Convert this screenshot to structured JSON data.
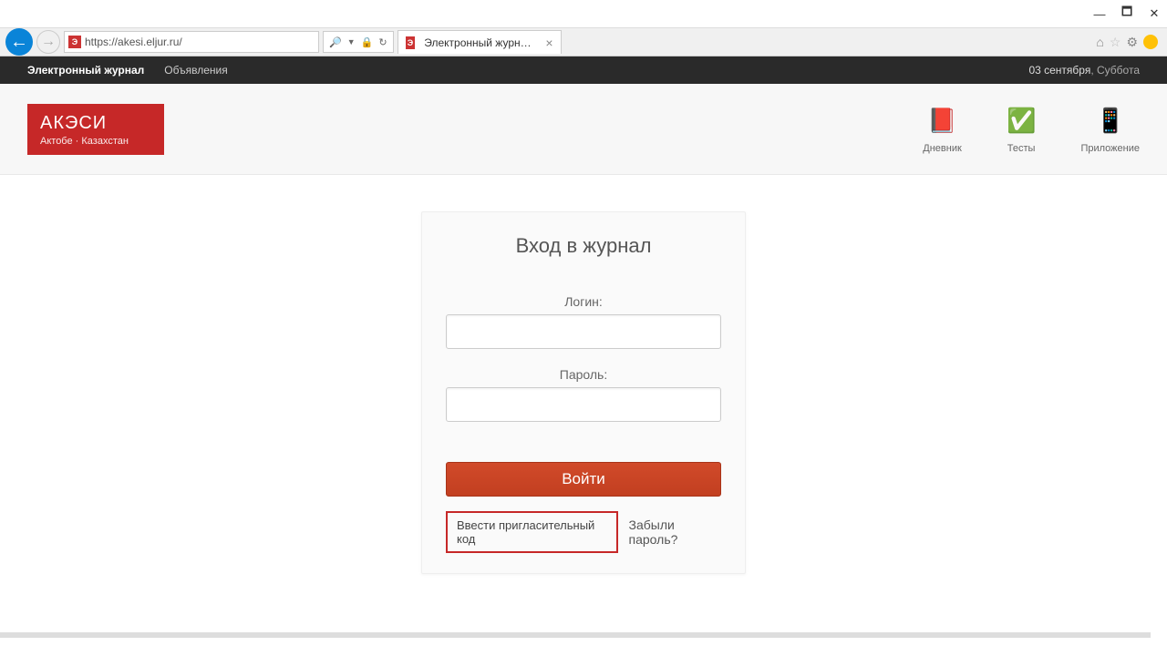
{
  "browser": {
    "url": "https://akesi.eljur.ru/",
    "search_icon": "🔍",
    "refresh_icon": "↻",
    "lock_icon": "🔒",
    "tab_title": "Электронный журнал — А...",
    "tab_icon": "Э"
  },
  "topbar": {
    "nav": {
      "journal": "Электронный журнал",
      "announcements": "Объявления"
    },
    "date": "03 сентября",
    "day": ", Суббота"
  },
  "logo": {
    "title": "АКЭСИ",
    "subtitle": "Актобе · Казахстан"
  },
  "header_icons": {
    "diary": {
      "label": "Дневник",
      "glyph": "📕"
    },
    "tests": {
      "label": "Тесты",
      "glyph": "✅"
    },
    "app": {
      "label": "Приложение",
      "glyph": "📱"
    }
  },
  "login": {
    "title": "Вход в журнал",
    "login_label": "Логин:",
    "password_label": "Пароль:",
    "login_value": "",
    "password_value": "",
    "submit": "Войти",
    "invite": "Ввести пригласительный код",
    "forgot": "Забыли пароль?"
  }
}
